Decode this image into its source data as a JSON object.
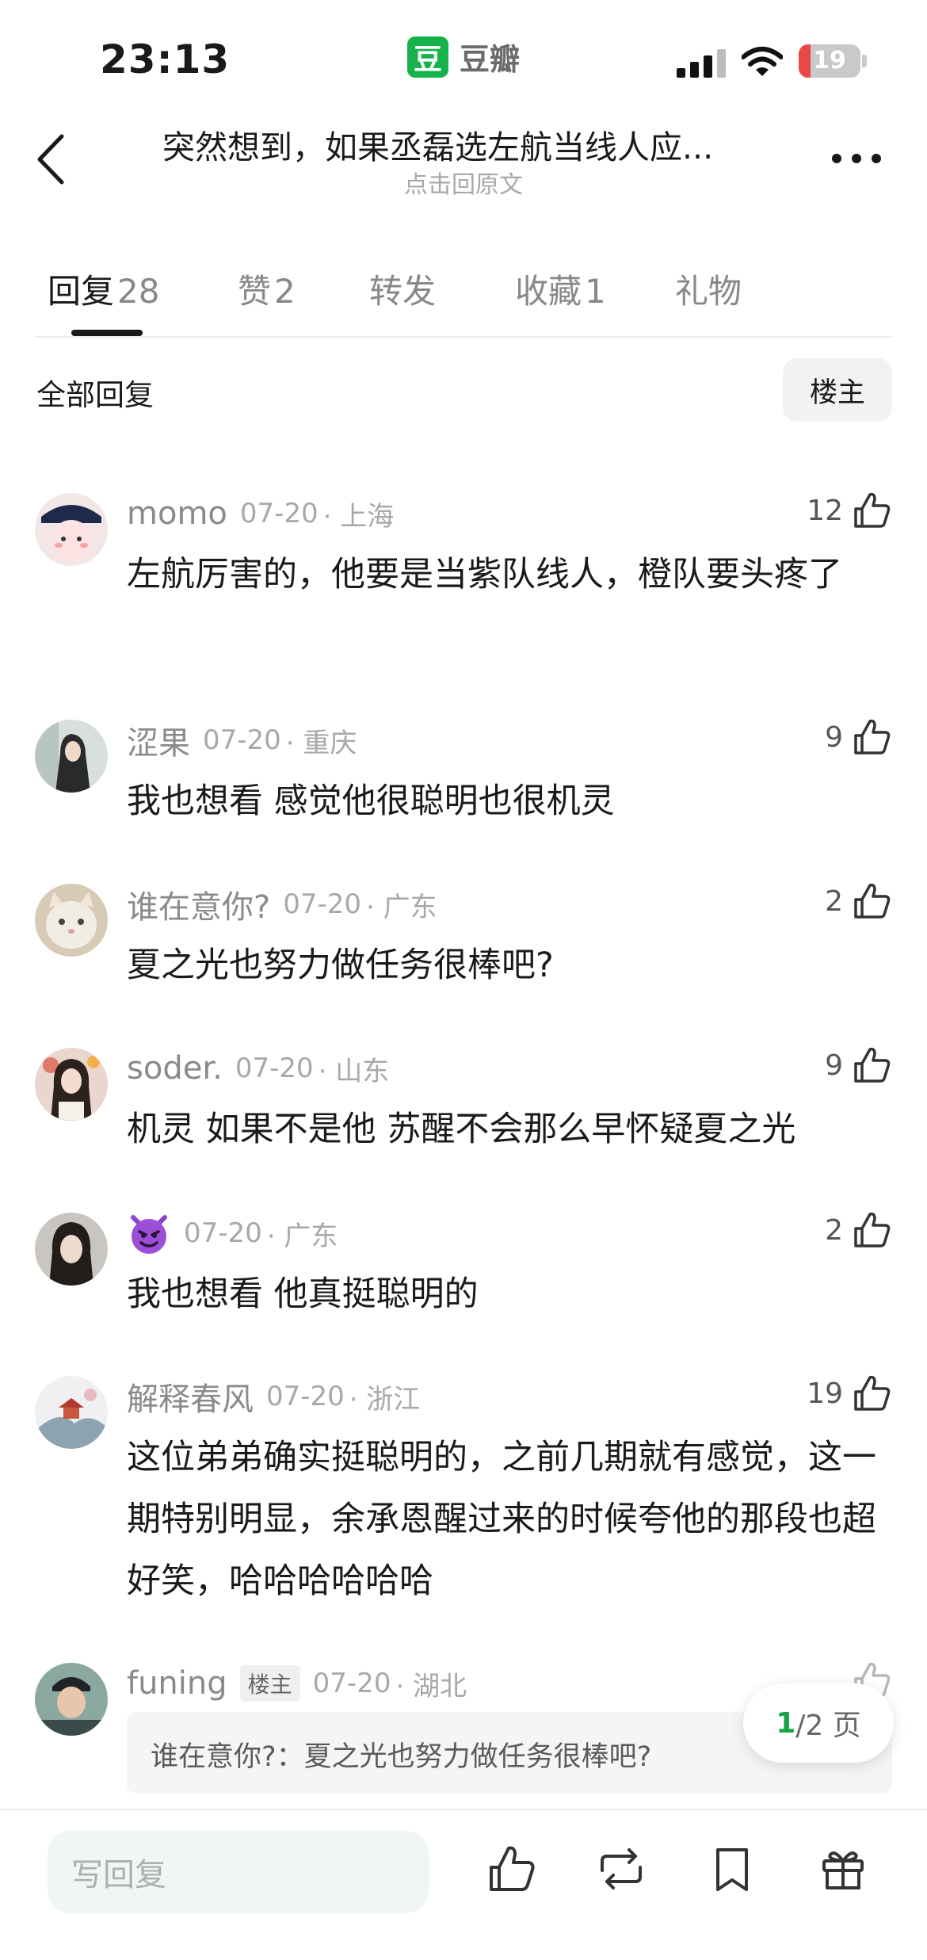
{
  "status_bar": {
    "time": "23:13",
    "app_logo_char": "豆",
    "app_name": "豆瓣",
    "battery": "19",
    "battery_level": 0.19
  },
  "nav": {
    "title": "突然想到，如果丞磊选左航当线人应...",
    "subtitle": "点击回原文"
  },
  "tabs": [
    {
      "label": "回复",
      "count": "28",
      "active": true
    },
    {
      "label": "赞",
      "count": "2",
      "active": false
    },
    {
      "label": "转发",
      "count": "",
      "active": false
    },
    {
      "label": "收藏",
      "count": "1",
      "active": false
    },
    {
      "label": "礼物",
      "count": "",
      "active": false
    }
  ],
  "filter": {
    "label": "全部回复",
    "op_button": "楼主"
  },
  "comments": [
    {
      "name": "momo",
      "date": "07-20",
      "location": "上海",
      "likes": "12",
      "text": "左航厉害的，他要是当紫队线人，橙队要头疼了"
    },
    {
      "name": "涩果",
      "date": "07-20",
      "location": "重庆",
      "likes": "9",
      "text": "我也想看 感觉他很聪明也很机灵"
    },
    {
      "name": "谁在意你?",
      "date": "07-20",
      "location": "广东",
      "likes": "2",
      "text": "夏之光也努力做任务很棒吧?"
    },
    {
      "name": "soder.",
      "date": "07-20",
      "location": "山东",
      "likes": "9",
      "text": "机灵 如果不是他 苏醒不会那么早怀疑夏之光"
    },
    {
      "name": "",
      "name_icon": "purple-devil-emoji",
      "date": "07-20",
      "location": "广东",
      "likes": "2",
      "text": "我也想看 他真挺聪明的"
    },
    {
      "name": "解释春风",
      "date": "07-20",
      "location": "浙江",
      "likes": "19",
      "text": "这位弟弟确实挺聪明的，之前几期就有感觉，这一期特别明显，余承恩醒过来的时候夸他的那段也超好笑，哈哈哈哈哈哈"
    },
    {
      "name": "funing",
      "op_tag": "楼主",
      "date": "07-20",
      "location": "湖北",
      "likes": "",
      "text": ""
    }
  ],
  "quote": "谁在意你?：夏之光也努力做任务很棒吧?",
  "pager": {
    "current": "1",
    "total": "/2 页"
  },
  "bottom_bar": {
    "reply_placeholder": "写回复",
    "icons": [
      "thumbs-up-icon",
      "repost-icon",
      "bookmark-icon",
      "gift-icon"
    ]
  },
  "colors": {
    "brand_green": "#17b34a",
    "battery_red": "#ea4848",
    "pager_green": "#17a34a"
  }
}
